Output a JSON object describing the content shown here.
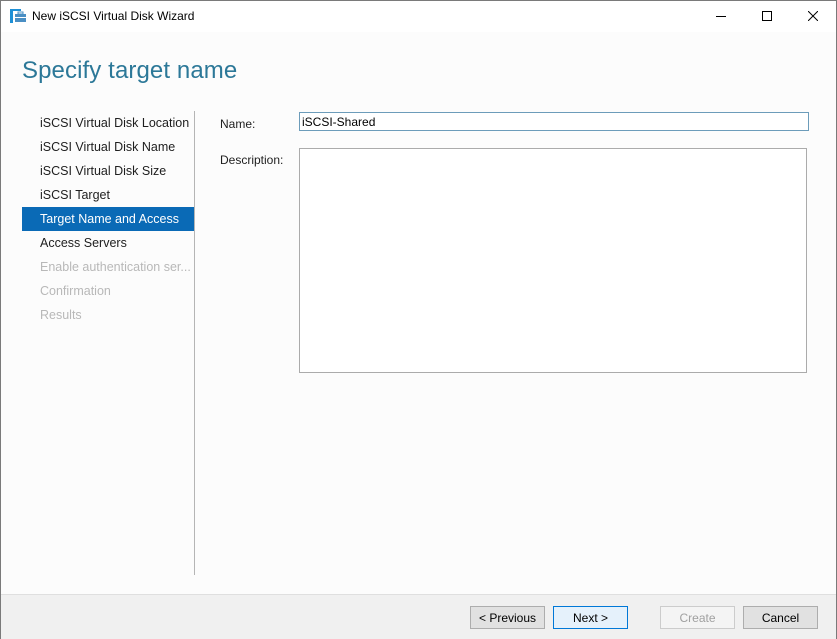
{
  "window": {
    "title": "New iSCSI Virtual Disk Wizard",
    "app_icon": "wizard-toolbox-icon",
    "controls": {
      "minimize": "minimize-icon",
      "maximize": "maximize-icon",
      "close": "close-icon"
    }
  },
  "page": {
    "heading": "Specify target name"
  },
  "nav": {
    "items": [
      {
        "label": "iSCSI Virtual Disk Location",
        "state": "normal"
      },
      {
        "label": "iSCSI Virtual Disk Name",
        "state": "normal"
      },
      {
        "label": "iSCSI Virtual Disk Size",
        "state": "normal"
      },
      {
        "label": "iSCSI Target",
        "state": "normal"
      },
      {
        "label": "Target Name and Access",
        "state": "active"
      },
      {
        "label": "Access Servers",
        "state": "normal"
      },
      {
        "label": "Enable authentication ser...",
        "state": "disabled"
      },
      {
        "label": "Confirmation",
        "state": "disabled"
      },
      {
        "label": "Results",
        "state": "disabled"
      }
    ]
  },
  "form": {
    "name_label": "Name:",
    "name_value": "iSCSI-Shared",
    "description_label": "Description:",
    "description_value": ""
  },
  "footer": {
    "previous_label": "< Previous",
    "next_label": "Next >",
    "create_label": "Create",
    "cancel_label": "Cancel"
  },
  "colors": {
    "heading": "#2c7898",
    "active_nav": "#0a6ab6",
    "disabled_text": "#b8b8b8",
    "primary_button_border": "#0078d7"
  }
}
